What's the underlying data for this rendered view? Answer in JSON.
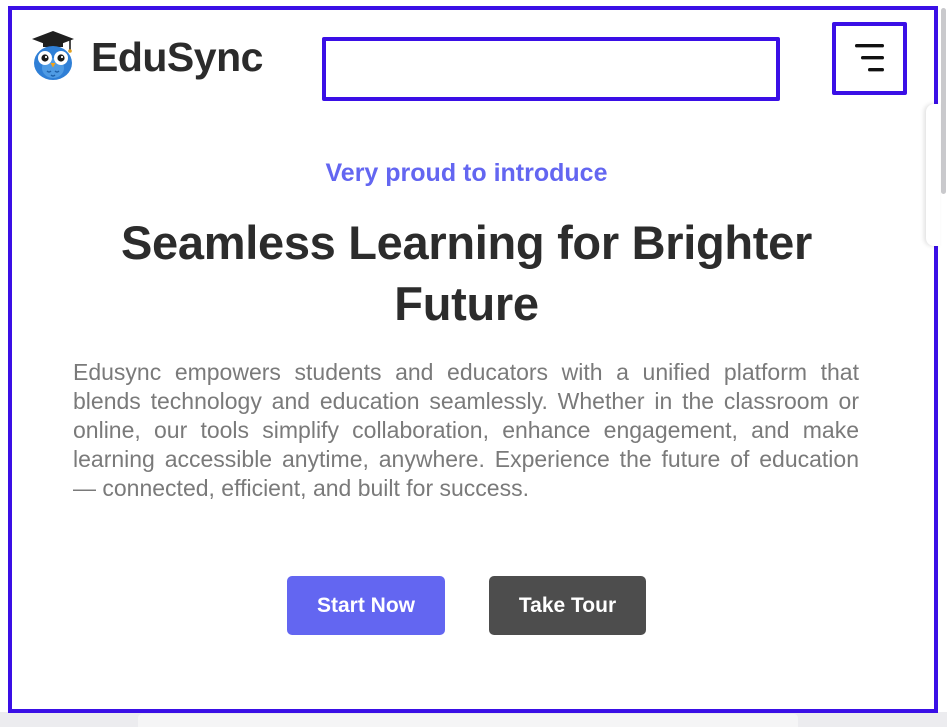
{
  "header": {
    "brand": "EduSync",
    "search": {
      "value": "",
      "placeholder": ""
    },
    "menu_icon": "menu-lines-icon",
    "logo_icon": "owl-graduation-cap-icon"
  },
  "hero": {
    "eyebrow": "Very proud to introduce",
    "headline": "Seamless Learning for Brighter Future",
    "description": "Edusync empowers students and educators with a unified platform that blends technology and education seamlessly. Whether in the classroom or online, our tools simplify collaboration, enhance engagement, and make learning accessible anytime, anywhere. Experience the future of education — connected, efficient, and built for success.",
    "primary_button": "Start Now",
    "secondary_button": "Take Tour"
  },
  "colors": {
    "accent": "#6366f1",
    "highlight_border": "#3a0fe6",
    "text_dark": "#2c2c2c",
    "text_muted": "#7a7a7a",
    "button_dark": "#4d4d4d"
  }
}
